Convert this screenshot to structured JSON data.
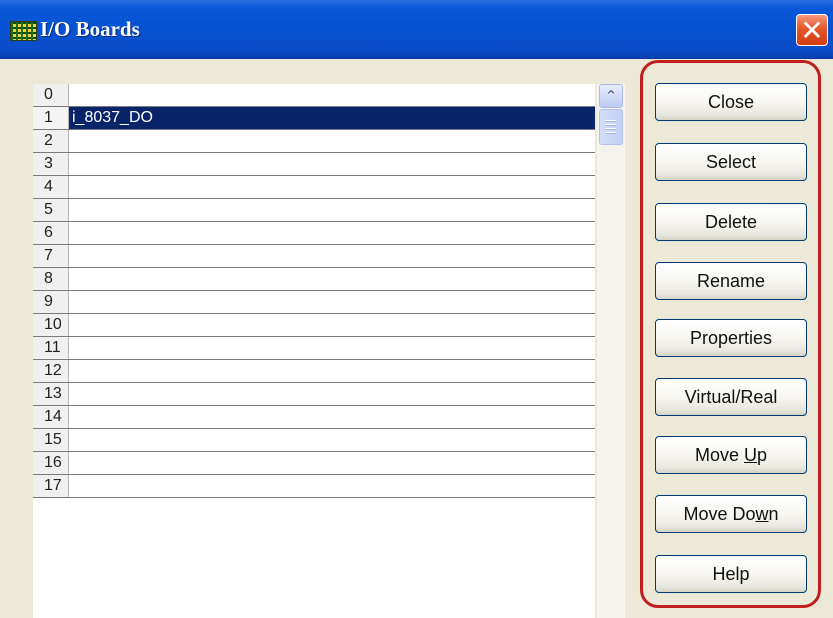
{
  "window": {
    "title": "I/O Boards",
    "icon": "grid-app-icon",
    "close_glyph": "✕"
  },
  "list": {
    "rows": [
      {
        "num": "0",
        "name": ""
      },
      {
        "num": "1",
        "name": "i_8037_DO",
        "selected": true
      },
      {
        "num": "2",
        "name": ""
      },
      {
        "num": "3",
        "name": ""
      },
      {
        "num": "4",
        "name": ""
      },
      {
        "num": "5",
        "name": ""
      },
      {
        "num": "6",
        "name": ""
      },
      {
        "num": "7",
        "name": ""
      },
      {
        "num": "8",
        "name": ""
      },
      {
        "num": "9",
        "name": ""
      },
      {
        "num": "10",
        "name": ""
      },
      {
        "num": "11",
        "name": ""
      },
      {
        "num": "12",
        "name": ""
      },
      {
        "num": "13",
        "name": ""
      },
      {
        "num": "14",
        "name": ""
      },
      {
        "num": "15",
        "name": ""
      },
      {
        "num": "16",
        "name": ""
      },
      {
        "num": "17",
        "name": ""
      }
    ]
  },
  "scrollbar": {
    "up_glyph": "⌃"
  },
  "buttons": {
    "close": "Close",
    "select": "Select",
    "delete": "Delete",
    "rename": "Rename",
    "properties": "Properties",
    "virtual_real": "Virtual/Real",
    "move_up_pre": "Move ",
    "move_up_key": "U",
    "move_up_post": "p",
    "move_down_pre": "Move Do",
    "move_down_key": "w",
    "move_down_post": "n",
    "help": "Help"
  },
  "colors": {
    "selection": "#0a246a",
    "highlight_border": "#c0201d",
    "titlebar": "#0552d3"
  }
}
